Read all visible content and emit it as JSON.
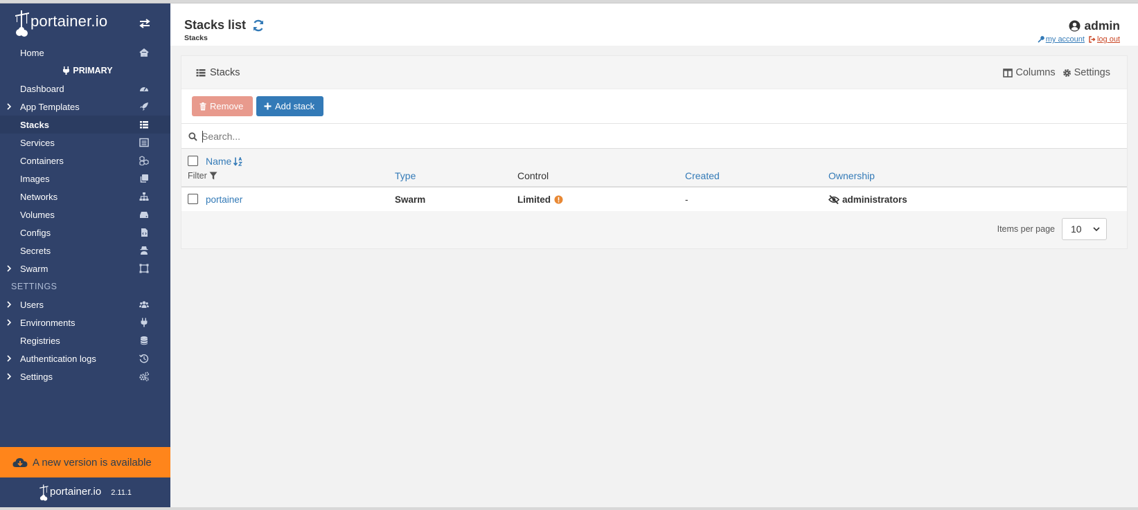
{
  "sidebar": {
    "brand": "portainer.io",
    "items_top": [
      {
        "label": "Home",
        "icon": "home-icon",
        "chevron": false,
        "active": false
      }
    ],
    "environment_name": "PRIMARY",
    "env_items": [
      {
        "label": "Dashboard",
        "icon": "tachometer-icon",
        "chevron": false,
        "active": false
      },
      {
        "label": "App Templates",
        "icon": "rocket-icon",
        "chevron": true,
        "active": false
      },
      {
        "label": "Stacks",
        "icon": "th-list-icon",
        "chevron": false,
        "active": true
      },
      {
        "label": "Services",
        "icon": "list-alt-icon",
        "chevron": false,
        "active": false
      },
      {
        "label": "Containers",
        "icon": "cubes-icon",
        "chevron": false,
        "active": false
      },
      {
        "label": "Images",
        "icon": "clone-icon",
        "chevron": false,
        "active": false
      },
      {
        "label": "Networks",
        "icon": "sitemap-icon",
        "chevron": false,
        "active": false
      },
      {
        "label": "Volumes",
        "icon": "hdd-icon",
        "chevron": false,
        "active": false
      },
      {
        "label": "Configs",
        "icon": "file-code-icon",
        "chevron": false,
        "active": false
      },
      {
        "label": "Secrets",
        "icon": "user-secret-icon",
        "chevron": false,
        "active": false
      },
      {
        "label": "Swarm",
        "icon": "object-group-icon",
        "chevron": true,
        "active": false
      }
    ],
    "settings_title": "SETTINGS",
    "settings_items": [
      {
        "label": "Users",
        "icon": "users-icon",
        "chevron": true,
        "active": false
      },
      {
        "label": "Environments",
        "icon": "plug-icon",
        "chevron": true,
        "active": false
      },
      {
        "label": "Registries",
        "icon": "database-icon",
        "chevron": false,
        "active": false
      },
      {
        "label": "Authentication logs",
        "icon": "history-icon",
        "chevron": true,
        "active": false
      },
      {
        "label": "Settings",
        "icon": "cogs-icon",
        "chevron": true,
        "active": false
      }
    ],
    "update_banner": "A new version is available",
    "footer_brand": "portainer.io",
    "version": "2.11.1"
  },
  "header": {
    "title": "Stacks list",
    "breadcrumb": "Stacks",
    "username": "admin",
    "my_account": "my account",
    "log_out": "log out"
  },
  "widget": {
    "title": "Stacks",
    "columns_label": "Columns",
    "settings_label": "Settings",
    "remove_label": "Remove",
    "add_label": "Add stack",
    "search_placeholder": "Search...",
    "filter_label": "Filter",
    "columns": [
      "Name",
      "Type",
      "Control",
      "Created",
      "Ownership"
    ],
    "rows": [
      {
        "name": "portainer",
        "type": "Swarm",
        "control": "Limited",
        "created": "-",
        "ownership": "administrators"
      }
    ],
    "items_per_page_label": "Items per page",
    "items_per_page": "10"
  },
  "colors": {
    "sidebar_bg": "#30426a",
    "primary": "#337ab7",
    "danger_disabled": "#e89a8d",
    "warning": "#ff851b",
    "logout": "#c94422"
  }
}
